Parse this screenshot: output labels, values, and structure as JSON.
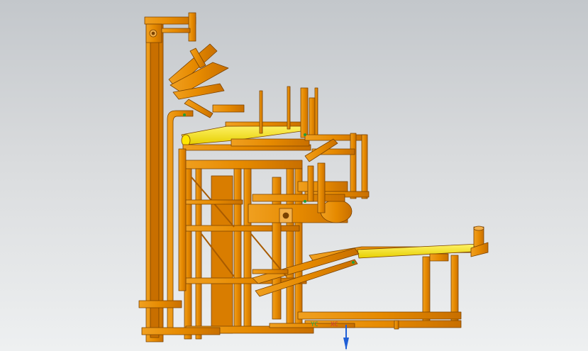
{
  "viewport": {
    "background_top": "#c3c7cb",
    "background_bottom": "#eef0f1"
  },
  "model": {
    "name": "palletizing-machine-assembly",
    "frame_color": "#e68a00",
    "frame_stroke": "#7a4200",
    "highlight_color": "#ffe600"
  },
  "triad": {
    "x_label": "XC",
    "y_label": "YC",
    "x_color": "#d23a3a",
    "y_color": "#2aa84a",
    "z_color": "#1f5fd6"
  }
}
